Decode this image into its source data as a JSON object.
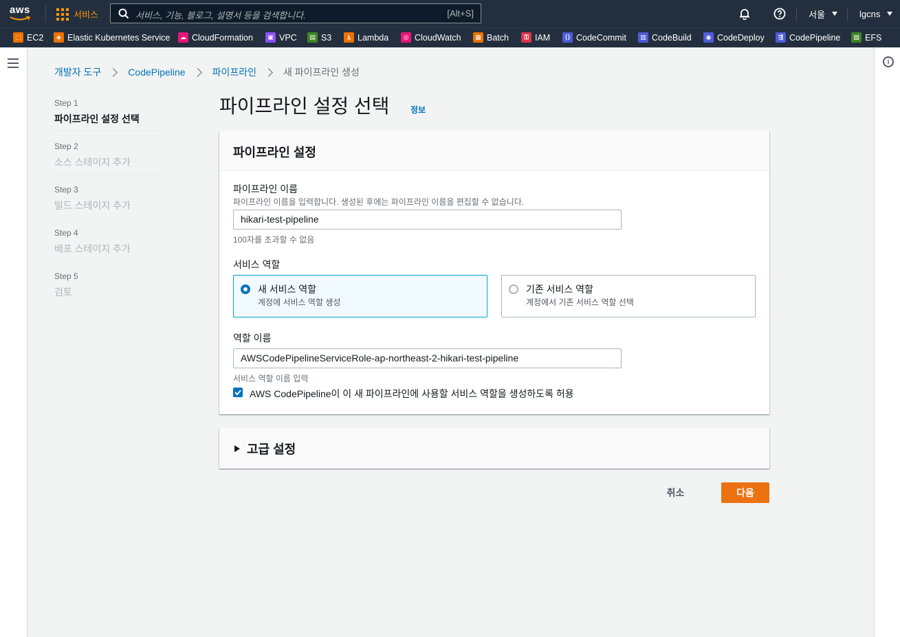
{
  "topnav": {
    "logo_text": "aws",
    "services_label": "서비스",
    "search_placeholder": "서비스, 기능, 블로그, 설명서 등을 검색합니다.",
    "search_shortcut": "[Alt+S]",
    "region": "서울",
    "account": "lgcns"
  },
  "favorites": [
    {
      "label": "EC2",
      "color": "#ed7100"
    },
    {
      "label": "Elastic Kubernetes Service",
      "color": "#ed7100"
    },
    {
      "label": "CloudFormation",
      "color": "#e7157b"
    },
    {
      "label": "VPC",
      "color": "#8c4fff"
    },
    {
      "label": "S3",
      "color": "#3f8624"
    },
    {
      "label": "Lambda",
      "color": "#ed7100"
    },
    {
      "label": "CloudWatch",
      "color": "#e7157b"
    },
    {
      "label": "Batch",
      "color": "#ed7100"
    },
    {
      "label": "IAM",
      "color": "#dd344c"
    },
    {
      "label": "CodeCommit",
      "color": "#4d5bd8"
    },
    {
      "label": "CodeBuild",
      "color": "#4d5bd8"
    },
    {
      "label": "CodeDeploy",
      "color": "#4d5bd8"
    },
    {
      "label": "CodePipeline",
      "color": "#4d5bd8"
    },
    {
      "label": "EFS",
      "color": "#3f8624"
    }
  ],
  "breadcrumb": [
    "개발자 도구",
    "CodePipeline",
    "파이프라인",
    "새 파이프라인 생성"
  ],
  "steps": [
    {
      "step": "Step 1",
      "name": "파이프라인 설정 선택"
    },
    {
      "step": "Step 2",
      "name": "소스 스테이지 추가"
    },
    {
      "step": "Step 3",
      "name": "빌드 스테이지 추가"
    },
    {
      "step": "Step 4",
      "name": "배포 스테이지 추가"
    },
    {
      "step": "Step 5",
      "name": "검토"
    }
  ],
  "page": {
    "title": "파이프라인 설정 선택",
    "info": "정보"
  },
  "settings": {
    "header": "파이프라인 설정",
    "name_label": "파이프라인 이름",
    "name_desc": "파이프라인 이름을 입력합니다. 생성된 후에는 파이프라인 이름을 편집할 수 없습니다.",
    "name_value": "hikari-test-pipeline",
    "name_constraint": "100자를 초과할 수 없음",
    "role_label": "서비스 역할",
    "role_new_title": "새 서비스 역할",
    "role_new_desc": "계정에 서비스 역할 생성",
    "role_existing_title": "기존 서비스 역할",
    "role_existing_desc": "계정에서 기존 서비스 역할 선택",
    "role_name_label": "역할 이름",
    "role_name_value": "AWSCodePipelineServiceRole-ap-northeast-2-hikari-test-pipeline",
    "role_name_constraint": "서비스 역할 이름 입력",
    "allow_checkbox_label": "AWS CodePipeline이 이 새 파이프라인에 사용할 서비스 역할을 생성하도록 허용"
  },
  "advanced": {
    "label": "고급 설정"
  },
  "actions": {
    "cancel": "취소",
    "next": "다음"
  }
}
